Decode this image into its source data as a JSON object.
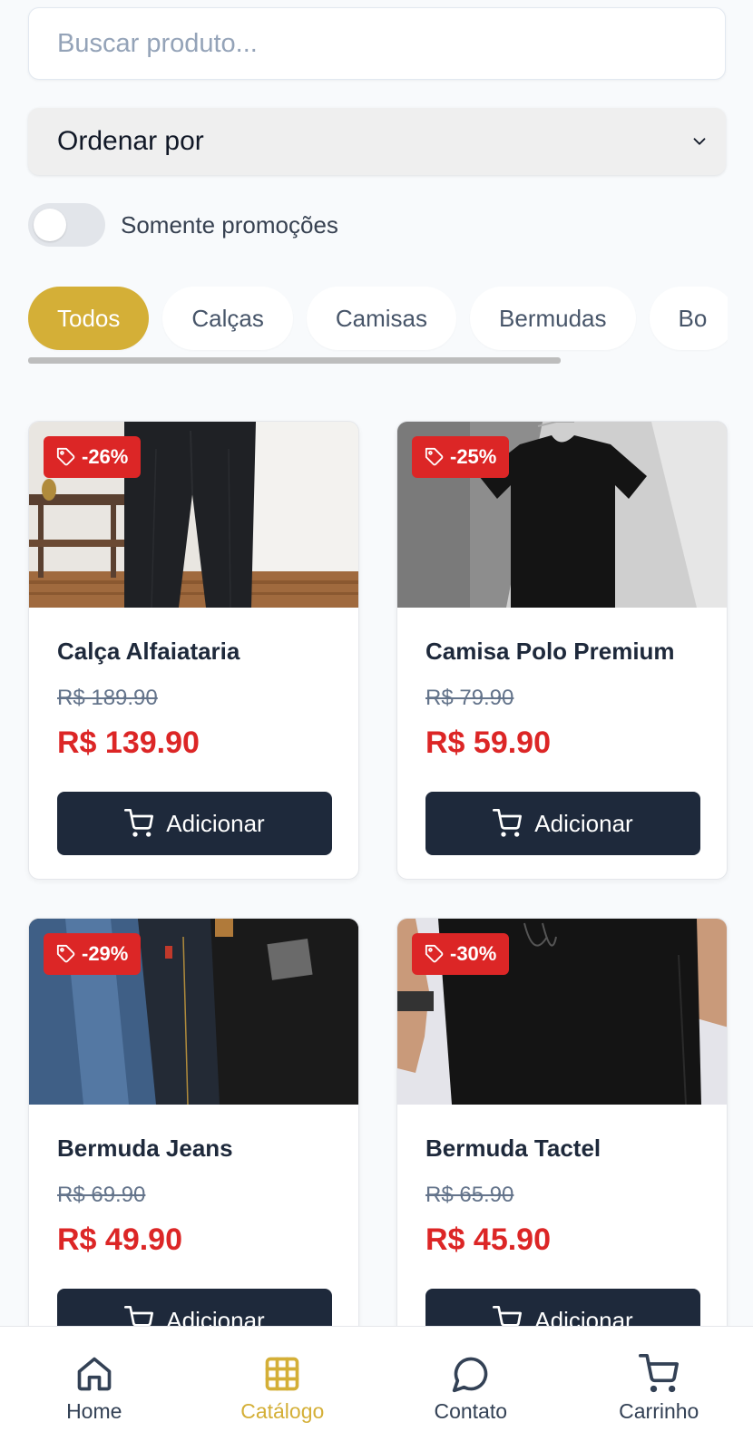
{
  "search": {
    "placeholder": "Buscar produto..."
  },
  "sort": {
    "label": "Ordenar por"
  },
  "promo_toggle": {
    "label": "Somente promoções",
    "checked": false
  },
  "categories": [
    {
      "label": "Todos",
      "active": true
    },
    {
      "label": "Calças",
      "active": false
    },
    {
      "label": "Camisas",
      "active": false
    },
    {
      "label": "Bermudas",
      "active": false
    },
    {
      "label": "Bo",
      "active": false
    }
  ],
  "products": [
    {
      "name": "Calça Alfaiataria",
      "discount": "-26%",
      "old_price": "R$ 189.90",
      "price": "R$ 139.90",
      "button": "Adicionar"
    },
    {
      "name": "Camisa Polo Premium",
      "discount": "-25%",
      "old_price": "R$ 79.90",
      "price": "R$ 59.90",
      "button": "Adicionar"
    },
    {
      "name": "Bermuda Jeans",
      "discount": "-29%",
      "old_price": "R$ 69.90",
      "price": "R$ 49.90",
      "button": "Adicionar"
    },
    {
      "name": "Bermuda Tactel",
      "discount": "-30%",
      "old_price": "R$ 65.90",
      "price": "R$ 45.90",
      "button": "Adicionar"
    }
  ],
  "nav": [
    {
      "label": "Home",
      "icon": "home-icon",
      "active": false
    },
    {
      "label": "Catálogo",
      "icon": "grid-icon",
      "active": true
    },
    {
      "label": "Contato",
      "icon": "chat-icon",
      "active": false
    },
    {
      "label": "Carrinho",
      "icon": "cart-icon",
      "active": false
    }
  ],
  "colors": {
    "accent": "#d4af37",
    "discount": "#dc2626",
    "button": "#1e293b",
    "background": "#f8fafc"
  }
}
